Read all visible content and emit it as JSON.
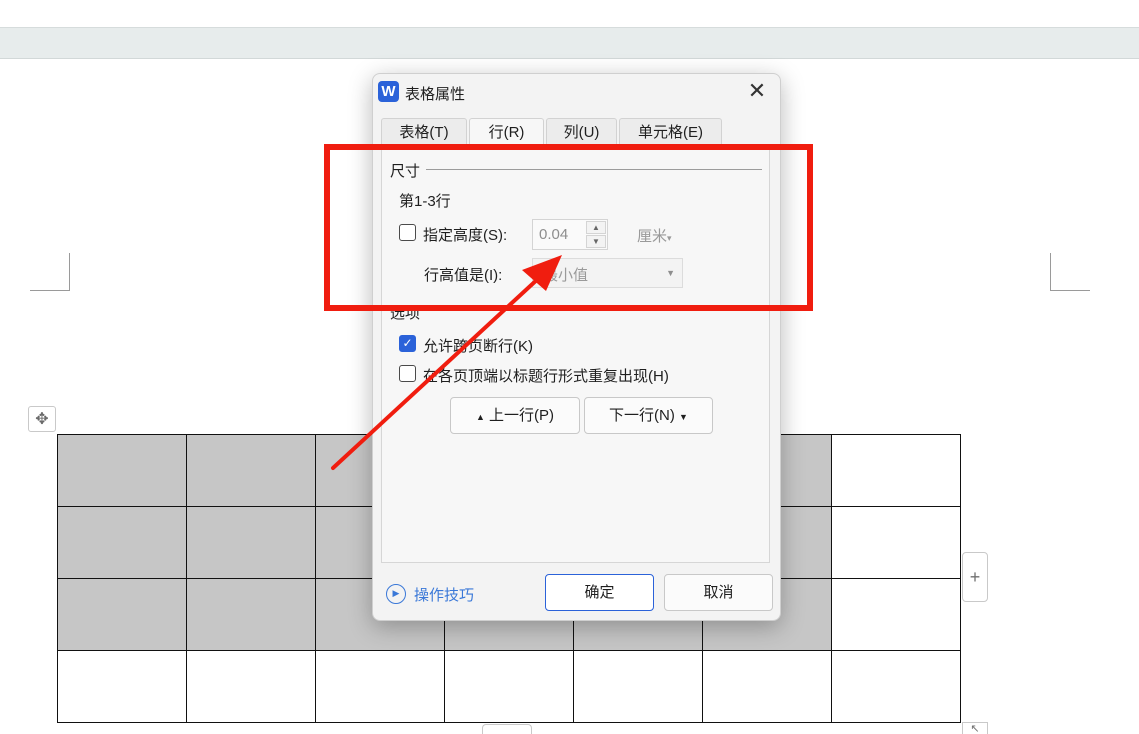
{
  "dialog": {
    "app_icon": "W",
    "title": "表格属性",
    "close_glyph": "✕",
    "tabs": [
      {
        "label": "表格(T)"
      },
      {
        "label": "行(R)"
      },
      {
        "label": "列(U)"
      },
      {
        "label": "单元格(E)"
      }
    ],
    "active_tab": "行(R)",
    "size_group": {
      "label": "尺寸",
      "rows_label": "第1-3行",
      "specify_height": {
        "label": "指定高度(S):",
        "checked": false
      },
      "height_value": "0.04",
      "unit_label": "厘米",
      "row_height_label": "行高值是(I):",
      "row_height_option": "最小值"
    },
    "options_group": {
      "label": "选项",
      "allow_break": {
        "label": "允许跨页断行(K)",
        "checked": true
      },
      "repeat_header": {
        "label": "在各页顶端以标题行形式重复出现(H)",
        "checked": false
      }
    },
    "prev_row_button": "上一行(P)",
    "next_row_button": "下一行(N)",
    "tips_link": "操作技巧",
    "ok_button": "确定",
    "cancel_button": "取消"
  },
  "document": {
    "table": {
      "rows": 4,
      "columns": 7,
      "selected_rows": [
        1,
        2,
        3
      ]
    }
  },
  "colors": {
    "accent": "#2b62d9",
    "highlight": "#f01d0f",
    "selection": "#c6c6c6"
  },
  "icons": [
    "app-w-icon",
    "close-icon",
    "move-handle-icon",
    "add-column-icon",
    "add-row-icon",
    "tips-icon",
    "up-arrow-icon",
    "down-arrow-icon"
  ]
}
